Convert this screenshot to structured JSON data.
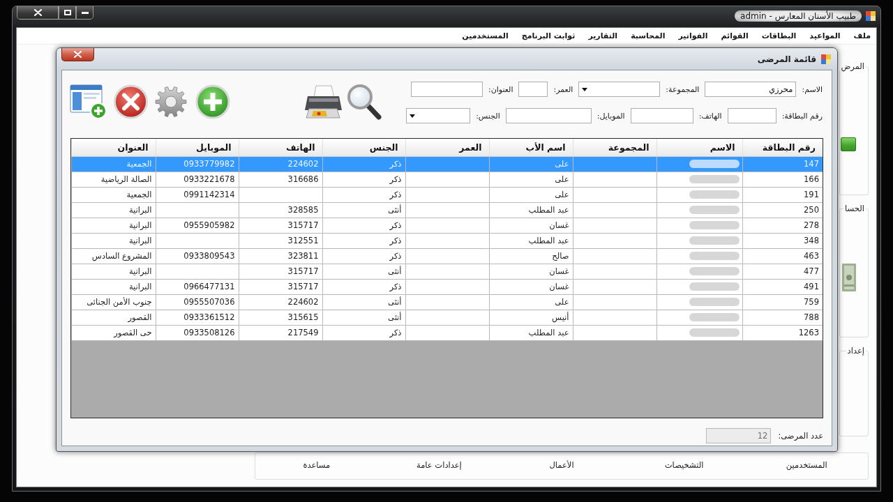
{
  "window": {
    "title": "طبيب الأسنان المعارس - admin"
  },
  "menu": [
    "ملف",
    "المواعيد",
    "البطاقات",
    "القوائم",
    "الفواتير",
    "المحاسبة",
    "التقارير",
    "ثوابت البرنامج",
    "المستخدمين"
  ],
  "side_panels": [
    {
      "title": "المرض",
      "kind": "button"
    },
    {
      "title": "الحسا",
      "kind": "money"
    },
    {
      "title": "إعداد",
      "kind": "plain"
    }
  ],
  "bottom_panel": {
    "items": [
      "المستخدمين",
      "التشخيصات",
      "الأعمال",
      "إعدادات عامة",
      "مساعدة"
    ]
  },
  "dialog": {
    "title": "قائمة المرضى",
    "filters": [
      [
        {
          "label": "الاسم:",
          "kind": "text",
          "value": "محرزي"
        },
        {
          "label": "المجموعة:",
          "kind": "dropdown"
        },
        {
          "label": "العمر:",
          "kind": "text"
        },
        {
          "label": "العنوان:",
          "kind": "text"
        }
      ],
      [
        {
          "label": "رقم البطاقة:",
          "kind": "text"
        },
        {
          "label": "الهاتف:",
          "kind": "text"
        },
        {
          "label": "الموبايل:",
          "kind": "text"
        },
        {
          "label": "الجنس:",
          "kind": "dropdown"
        }
      ]
    ],
    "table": {
      "columns": [
        "رقم البطاقة",
        "الاسم",
        "المجموعة",
        "اسم الأب",
        "العمر",
        "الجنس",
        "الهاتف",
        "الموبايل",
        "العنوان"
      ],
      "rows": [
        {
          "selected": true,
          "card": "147",
          "father": "على",
          "gender": "ذكر",
          "phone": "224602",
          "mobile": "0933779982",
          "address": "الجمعية"
        },
        {
          "selected": false,
          "card": "166",
          "father": "على",
          "gender": "ذكر",
          "phone": "316686",
          "mobile": "0933221678",
          "address": "الصالة الرياضية"
        },
        {
          "selected": false,
          "card": "191",
          "father": "على",
          "gender": "ذكر",
          "mobile": "0991142314",
          "address": "الجمعية"
        },
        {
          "selected": false,
          "card": "250",
          "father": "عبد المطلب",
          "gender": "أنثى",
          "phone": "328585",
          "address": "البرانية"
        },
        {
          "selected": false,
          "card": "278",
          "father": "غسان",
          "gender": "ذكر",
          "phone": "315717",
          "mobile": "0955905982",
          "address": "البرانية"
        },
        {
          "selected": false,
          "card": "348",
          "father": "عبد المطلب",
          "gender": "ذكر",
          "phone": "312551",
          "address": "البرانية"
        },
        {
          "selected": false,
          "card": "463",
          "father": "صالح",
          "gender": "ذكر",
          "phone": "323811",
          "mobile": "0933809543",
          "address": "المشروع السادس"
        },
        {
          "selected": false,
          "card": "477",
          "father": "غسان",
          "gender": "أنثى",
          "phone": "315717",
          "address": "البرانية"
        },
        {
          "selected": false,
          "card": "491",
          "father": "غسان",
          "gender": "ذكر",
          "phone": "315717",
          "mobile": "0966477131",
          "address": "البرانية"
        },
        {
          "selected": false,
          "card": "759",
          "father": "على",
          "gender": "أنثى",
          "phone": "224602",
          "mobile": "0955507036",
          "address": "جنوب الأمن الجنائى"
        },
        {
          "selected": false,
          "card": "788",
          "father": "أنيس",
          "gender": "أنثى",
          "phone": "315615",
          "mobile": "0933361512",
          "address": "القصور"
        },
        {
          "selected": false,
          "card": "1263",
          "father": "عبد المطلب",
          "gender": "ذكر",
          "phone": "217549",
          "mobile": "0933508126",
          "address": "حى القصور"
        }
      ]
    },
    "count": {
      "label": "عدد المرضى:",
      "value": "12"
    }
  }
}
